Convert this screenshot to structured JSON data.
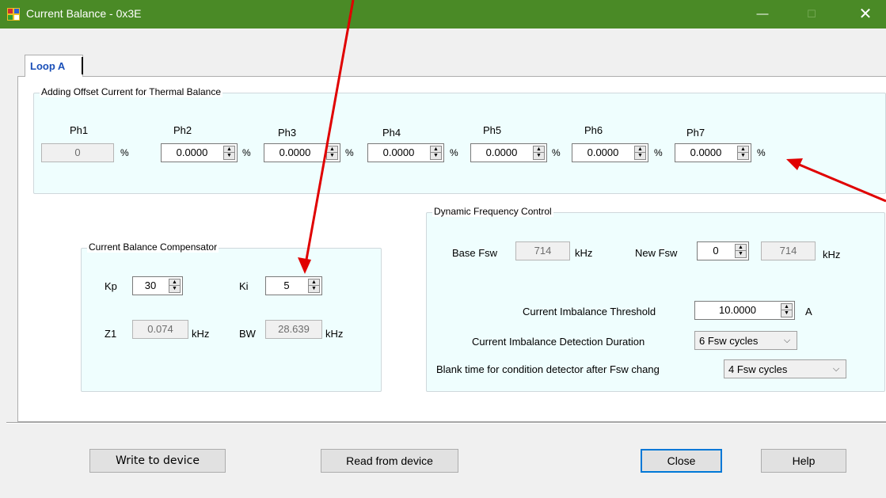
{
  "window": {
    "title": "Current Balance - 0x3E",
    "minimize_glyph": "—",
    "maximize_glyph": "☐",
    "close_glyph": "✕",
    "titlebar_color": "#4a8a26"
  },
  "tabs": [
    {
      "label": "Loop A",
      "selected": true
    }
  ],
  "thermal": {
    "legend": "Adding Offset Current for Thermal Balance",
    "unit": "%",
    "phases": [
      {
        "label": "Ph1",
        "value": "0",
        "readonly": true
      },
      {
        "label": "Ph2",
        "value": "0.0000"
      },
      {
        "label": "Ph3",
        "value": "0.0000"
      },
      {
        "label": "Ph4",
        "value": "0.0000"
      },
      {
        "label": "Ph5",
        "value": "0.0000"
      },
      {
        "label": "Ph6",
        "value": "0.0000"
      },
      {
        "label": "Ph7",
        "value": "0.0000"
      }
    ]
  },
  "compensator": {
    "legend": "Current Balance Compensator",
    "kp_label": "Kp",
    "kp_value": "30",
    "ki_label": "Ki",
    "ki_value": "5",
    "z1_label": "Z1",
    "z1_value": "0.074",
    "z1_unit": "kHz",
    "bw_label": "BW",
    "bw_value": "28.639",
    "bw_unit": "kHz"
  },
  "dfc": {
    "legend": "Dynamic Frequency Control",
    "base_fsw_label": "Base Fsw",
    "base_fsw_value": "714",
    "base_fsw_unit": "kHz",
    "new_fsw_label": "New Fsw",
    "new_fsw_value": "0",
    "new_fsw_result": "714",
    "new_fsw_unit": "kHz",
    "threshold_label": "Current Imbalance Threshold",
    "threshold_value": "10.0000",
    "threshold_unit": "A",
    "duration_label": "Current Imbalance Detection Duration",
    "duration_value": "6 Fsw cycles",
    "blank_label": "Blank time for condition detector after Fsw chang",
    "blank_value": "4 Fsw cycles"
  },
  "buttons": {
    "write": "Write to device",
    "read": "Read from device",
    "close": "Close",
    "help": "Help"
  },
  "annotation_color": "#e00000"
}
